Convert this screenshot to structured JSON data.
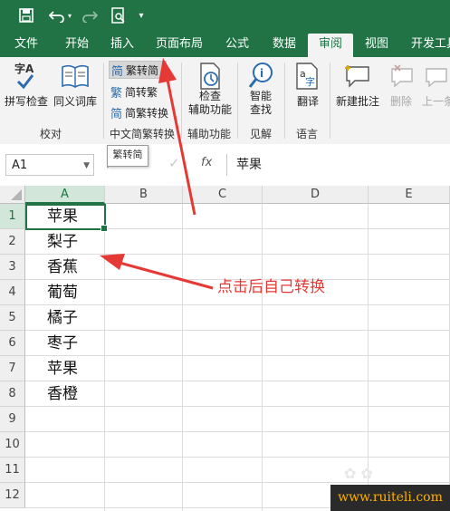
{
  "quick_access": {
    "save_icon": "save-icon",
    "undo_icon": "undo-icon",
    "redo_icon": "redo-icon",
    "preview_icon": "print-preview-icon",
    "customize_icon": "customize-icon"
  },
  "tabs": [
    "文件",
    "开始",
    "插入",
    "页面布局",
    "公式",
    "数据",
    "审阅",
    "视图",
    "开发工具"
  ],
  "active_tab": "审阅",
  "ribbon": {
    "proofing": {
      "spell": "拼写检查",
      "thesaurus": "同义词库",
      "label": "校对"
    },
    "chinese": {
      "trad_to_simp": "繁转简",
      "simp_to_trad": "简转繁",
      "convert": "简繁转换",
      "label": "中文简繁转换"
    },
    "accessibility": {
      "check_line1": "检查",
      "check_line2": "辅助功能",
      "label": "辅助功能"
    },
    "insights": {
      "smart_line1": "智能",
      "smart_line2": "查找",
      "label": "见解"
    },
    "language": {
      "translate": "翻译",
      "label": "语言"
    },
    "comments": {
      "new": "新建批注",
      "delete": "删除",
      "previous": "上一条"
    }
  },
  "tooltip": "繁转简",
  "formula_bar": {
    "name_box": "A1",
    "fx": "fx",
    "value": "苹果"
  },
  "columns": [
    "A",
    "B",
    "C",
    "D",
    "E"
  ],
  "rows": [
    "1",
    "2",
    "3",
    "4",
    "5",
    "6",
    "7",
    "8",
    "9",
    "10",
    "11",
    "12"
  ],
  "cells": [
    "苹果",
    "梨子",
    "香蕉",
    "葡萄",
    "橘子",
    "枣子",
    "苹果",
    "香橙"
  ],
  "annotation": "点击后自己转换",
  "watermark": "www.ruiteli.com",
  "colors": {
    "excel_green": "#217346",
    "annotation_red": "#e53935"
  }
}
